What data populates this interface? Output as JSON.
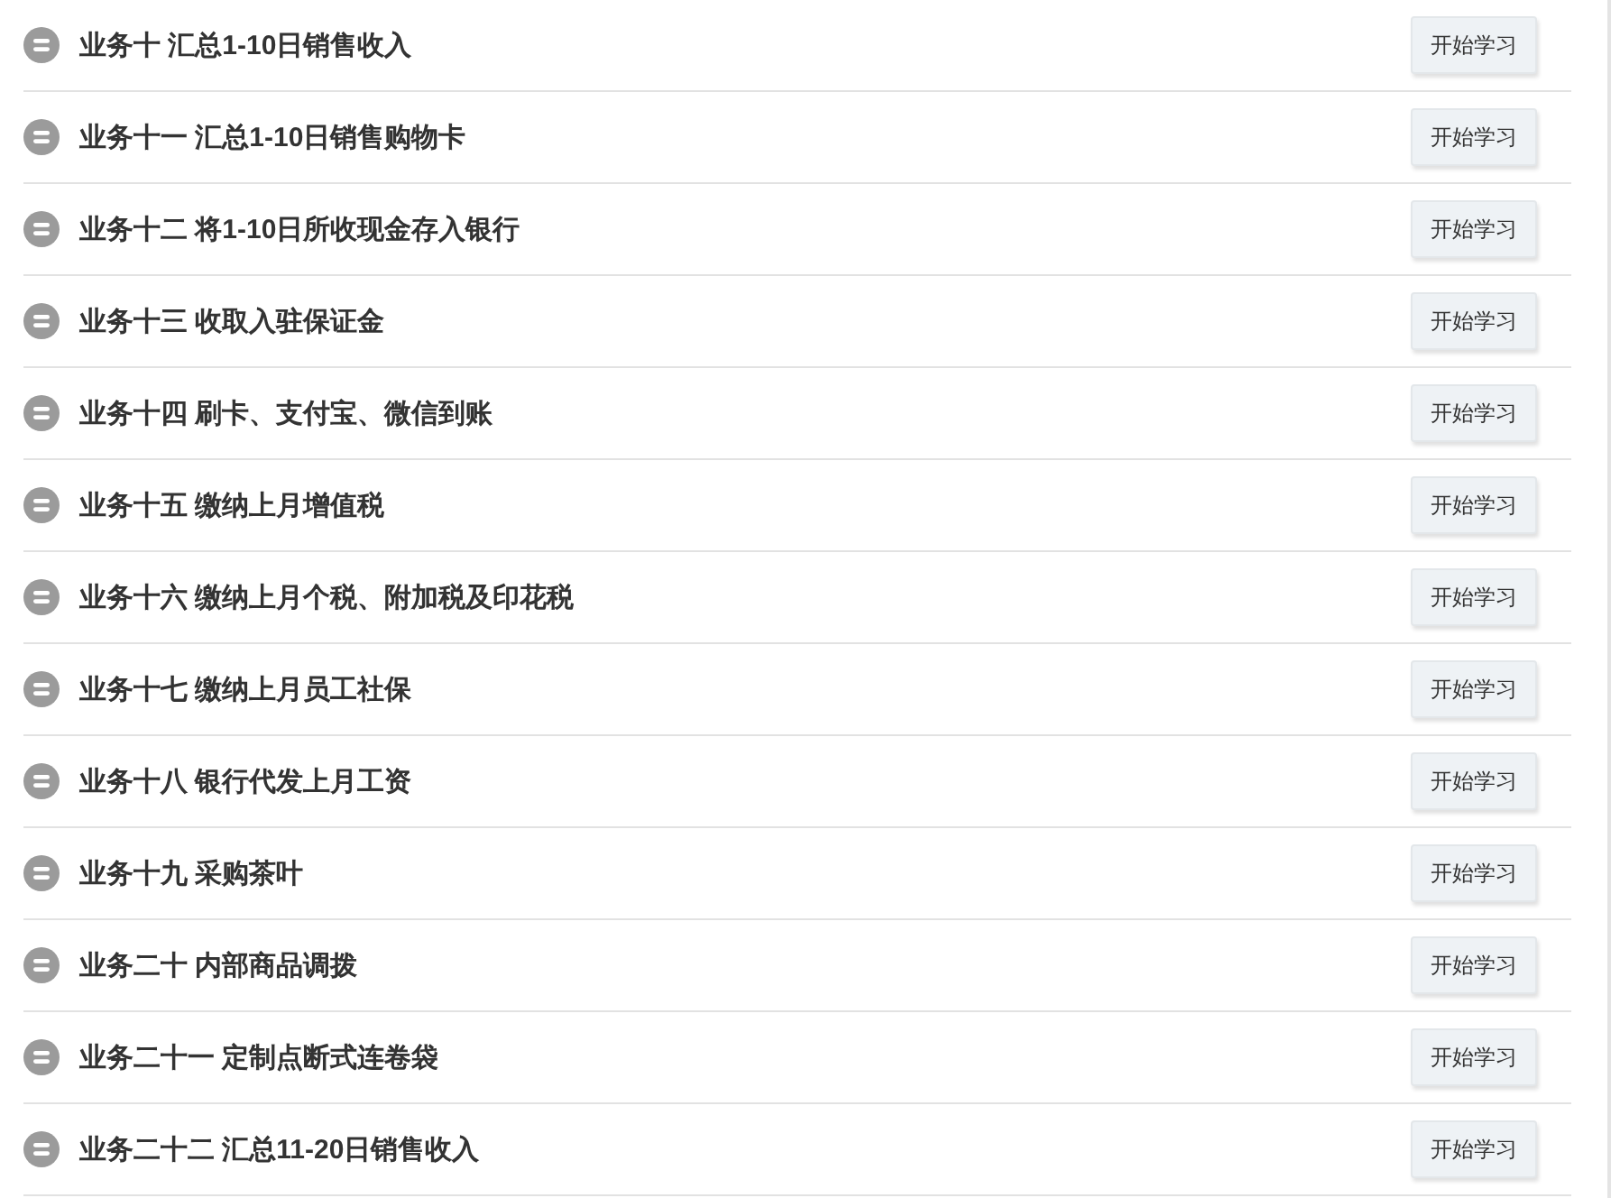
{
  "lessons": [
    {
      "title": "业务十 汇总1-10日销售收入",
      "button": "开始学习"
    },
    {
      "title": "业务十一 汇总1-10日销售购物卡",
      "button": "开始学习"
    },
    {
      "title": "业务十二 将1-10日所收现金存入银行",
      "button": "开始学习"
    },
    {
      "title": "业务十三 收取入驻保证金",
      "button": "开始学习"
    },
    {
      "title": "业务十四 刷卡、支付宝、微信到账",
      "button": "开始学习"
    },
    {
      "title": "业务十五 缴纳上月增值税",
      "button": "开始学习"
    },
    {
      "title": "业务十六 缴纳上月个税、附加税及印花税",
      "button": "开始学习"
    },
    {
      "title": "业务十七 缴纳上月员工社保",
      "button": "开始学习"
    },
    {
      "title": "业务十八 银行代发上月工资",
      "button": "开始学习"
    },
    {
      "title": "业务十九 采购茶叶",
      "button": "开始学习"
    },
    {
      "title": "业务二十 内部商品调拨",
      "button": "开始学习"
    },
    {
      "title": "业务二十一 定制点断式连卷袋",
      "button": "开始学习"
    },
    {
      "title": "业务二十二 汇总11-20日销售收入",
      "button": "开始学习"
    }
  ]
}
